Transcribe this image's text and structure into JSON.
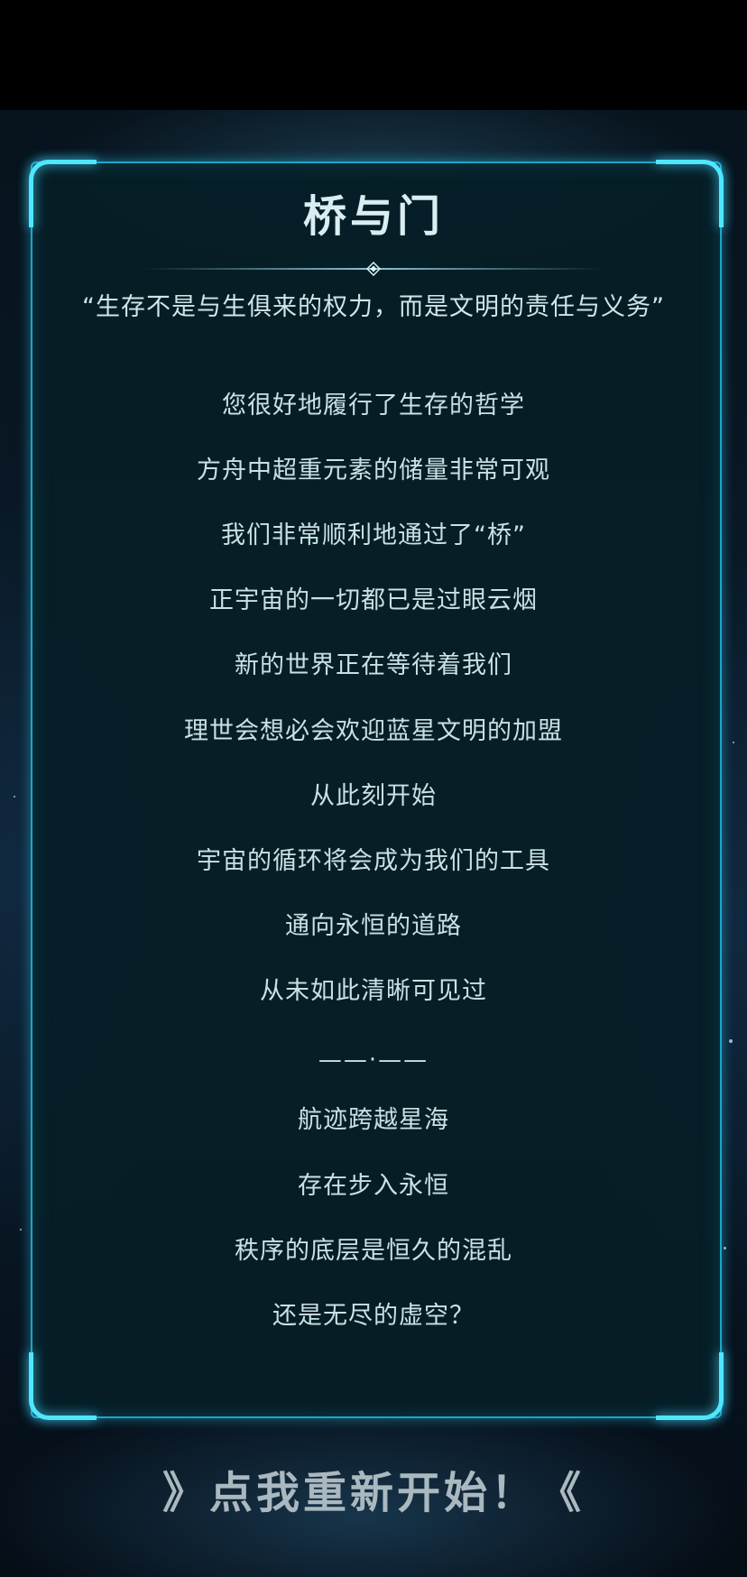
{
  "title": "桥与门",
  "quote": "“生存不是与生俱来的权力，而是文明的责任与义务”",
  "lines": [
    "您很好地履行了生存的哲学",
    "方舟中超重元素的储量非常可观",
    "我们非常顺利地通过了“桥”",
    "正宇宙的一切都已是过眼云烟",
    "新的世界正在等待着我们",
    "理世会想必会欢迎蓝星文明的加盟",
    "从此刻开始",
    "宇宙的循环将会成为我们的工具",
    "通向永恒的道路",
    "从未如此清晰可见过"
  ],
  "separator": "——·——",
  "closing_lines": [
    "航迹跨越星海",
    "存在步入永恒",
    "秩序的底层是恒久的混乱",
    "还是无尽的虚空？"
  ],
  "restart_label": "》点我重新开始！《",
  "colors": {
    "panel_border": "#1aa6c9",
    "corner_glow": "#4fe6ff",
    "text": "#c8e1e6"
  }
}
